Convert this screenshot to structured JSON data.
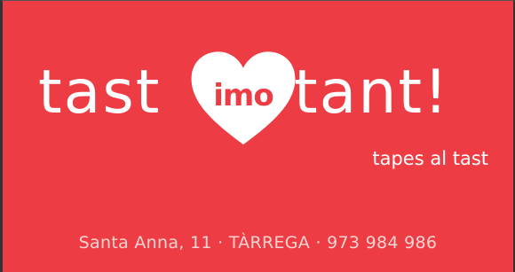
{
  "brand": {
    "word_left": "tast",
    "heart_word": "imo",
    "word_right": "tant!",
    "tagline": "tapes al tast"
  },
  "contact": {
    "address_line": "Santa Anna, 11 · TÀRREGA · 973 984 986"
  },
  "colors": {
    "background": "#ee3c45",
    "text": "#ffffff",
    "address_text": "#f7d4d1"
  },
  "icons": {
    "heart": "heart-icon"
  }
}
